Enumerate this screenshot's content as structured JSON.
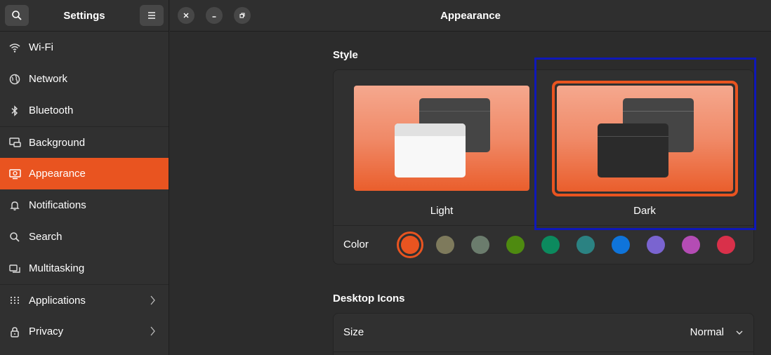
{
  "sidebar": {
    "title": "Settings",
    "items": [
      {
        "label": "Wi-Fi",
        "icon": "wifi-icon"
      },
      {
        "label": "Network",
        "icon": "network-icon"
      },
      {
        "label": "Bluetooth",
        "icon": "bluetooth-icon"
      },
      {
        "label": "Background",
        "icon": "background-icon"
      },
      {
        "label": "Appearance",
        "icon": "appearance-icon",
        "active": true
      },
      {
        "label": "Notifications",
        "icon": "bell-icon"
      },
      {
        "label": "Search",
        "icon": "search-icon"
      },
      {
        "label": "Multitasking",
        "icon": "multitasking-icon"
      },
      {
        "label": "Applications",
        "icon": "apps-grid-icon",
        "has_submenu": true
      },
      {
        "label": "Privacy",
        "icon": "lock-icon",
        "has_submenu": true
      }
    ]
  },
  "header": {
    "title": "Appearance"
  },
  "style_section": {
    "title": "Style",
    "options": [
      {
        "label": "Light",
        "selected": false
      },
      {
        "label": "Dark",
        "selected": true
      }
    ],
    "color_label": "Color",
    "colors": [
      "#e95420",
      "#7e7a5c",
      "#6b7c6d",
      "#4e8a10",
      "#0c8a5e",
      "#2b8282",
      "#0f74da",
      "#7a64d0",
      "#b44cb4",
      "#d9304a"
    ],
    "selected_color_index": 0
  },
  "desktop_icons": {
    "title": "Desktop Icons",
    "size_label": "Size",
    "size_value": "Normal"
  },
  "theme": {
    "accent": "#e95420",
    "focus_outline": "#0f18b8"
  }
}
